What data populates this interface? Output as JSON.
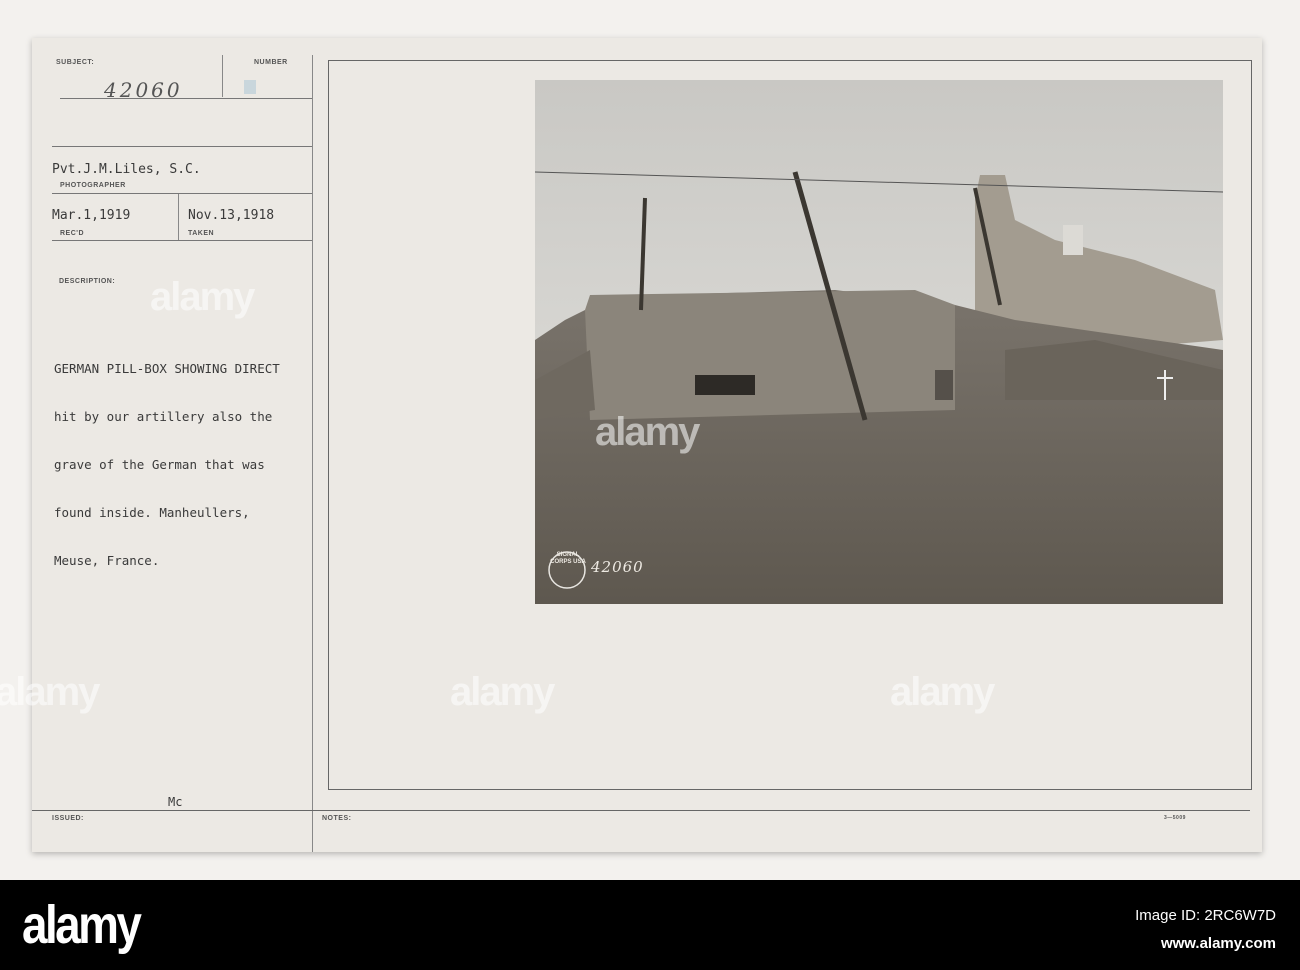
{
  "card": {
    "subject_label": "SUBJECT:",
    "number_label": "NUMBER",
    "subject_number": "42060",
    "photographer": "Pvt.J.M.Liles, S.C.",
    "photographer_label": "PHOTOGRAPHER",
    "received": "Mar.1,1919",
    "received_label": "REC'D",
    "taken": "Nov.13,1918",
    "taken_label": "TAKEN",
    "description_label": "DESCRIPTION:",
    "description_lines": [
      "GERMAN PILL-BOX SHOWING DIRECT",
      "hit by our artillery also the",
      "grave of the German that was",
      "found inside. Manheullers,",
      "Meuse, France."
    ],
    "issued_initials": "Mc",
    "issued_label": "ISSUED:",
    "notes_label": "NOTES:",
    "form_number": "3—5009",
    "photo_stamp_number": "42060",
    "photo_stamp_text": "SIGNAL CORPS USA"
  },
  "watermark": {
    "text": "alamy",
    "logo": "alamy",
    "image_id": "Image ID: 2RC6W7D",
    "site": "www.alamy.com"
  }
}
